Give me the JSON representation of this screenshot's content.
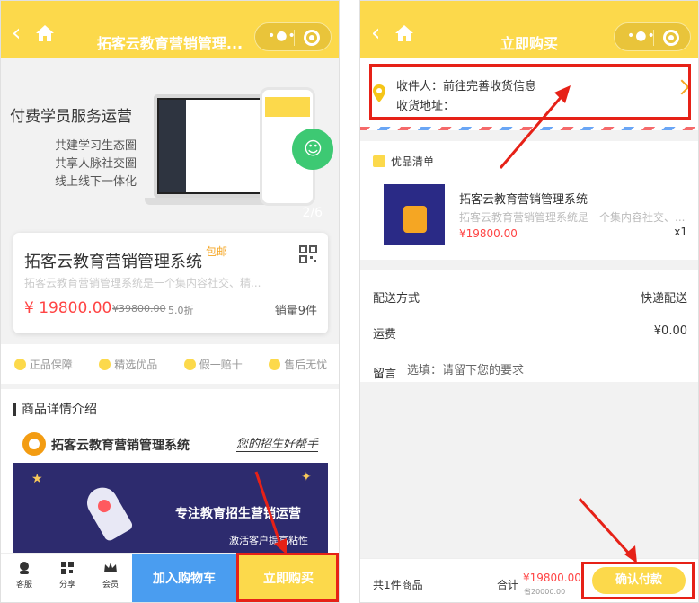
{
  "left": {
    "nav": {
      "title": "拓客云教育营销管理..."
    },
    "banner": {
      "heading": "付费学员服务运营",
      "lines": [
        "共建学习生态圈",
        "共享人脉社交圈",
        "线上线下一体化"
      ],
      "pager": "2/6"
    },
    "product": {
      "name": "拓客云教育营销管理系统",
      "shipping": "包邮",
      "desc": "拓客云教育营销管理系统是一个集内容社交、精...",
      "price": "¥ 19800.00",
      "original_price": "¥39800.00",
      "discount": "5.0折",
      "sales": "销量9件"
    },
    "guarantees": [
      "正品保障",
      "精选优品",
      "假一赔十",
      "售后无忧"
    ],
    "detail": {
      "heading": "商品详情介绍",
      "brand": "拓客云教育营销管理系统",
      "slogan": "您的招生好帮手",
      "promo_title": "专注教育招生营销运营",
      "promo_sub": "激活客户提高粘性"
    },
    "bottom": {
      "service": "客服",
      "share": "分享",
      "member": "会员",
      "add_cart": "加入购物车",
      "buy_now": "立即购买"
    }
  },
  "right": {
    "nav": {
      "title": "立即购买"
    },
    "address": {
      "receiver": "收件人：前往完善收货信息",
      "addr": "收货地址："
    },
    "goods": {
      "heading": "优品清单",
      "name": "拓客云教育营销管理系统",
      "desc": "拓客云教育营销管理系统是一个集内容社交、...",
      "price": "¥19800.00",
      "qty": "x1"
    },
    "options": {
      "delivery_label": "配送方式",
      "delivery_value": "快递配送",
      "freight_label": "运费",
      "freight_value": "¥0.00",
      "note_label": "留言",
      "note_placeholder": "选填：请留下您的要求"
    },
    "footer": {
      "count": "共1件商品",
      "total_label": "合计",
      "total": "¥19800.00",
      "original": "省20000.00",
      "pay": "确认付款"
    }
  },
  "colors": {
    "accent": "#fcd94b",
    "price": "#ff4444",
    "cart": "#4a9df0",
    "highlight": "#e62117"
  }
}
